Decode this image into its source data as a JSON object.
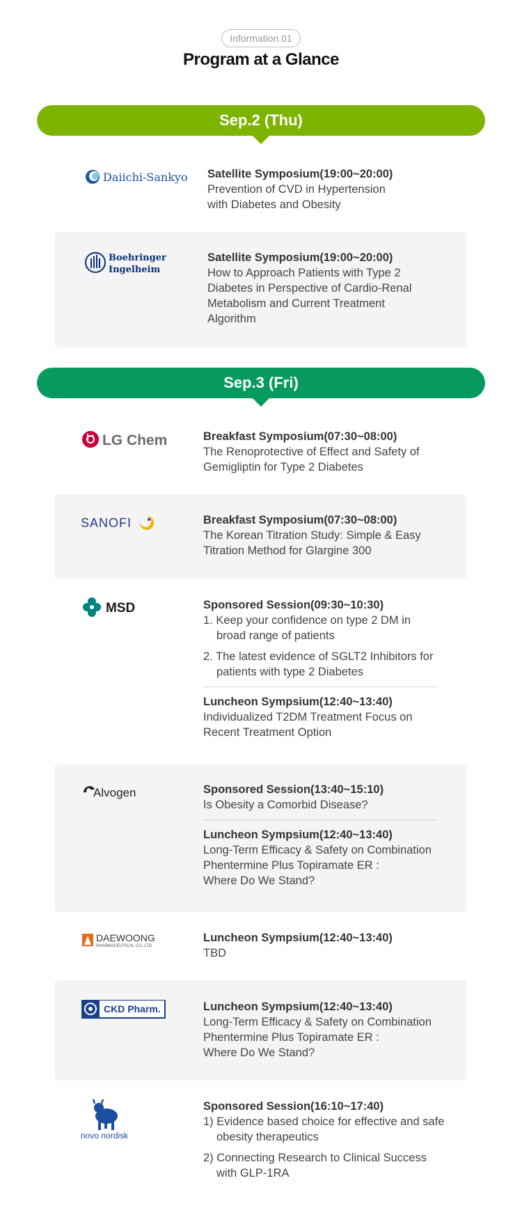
{
  "header": {
    "tag": "Information.01",
    "title": "Program at a Glance"
  },
  "days": [
    {
      "label": "Sep.2 (Thu)",
      "sessions": [
        {
          "sponsor": "Daiichi-Sankyo",
          "heading": "Satellite Symposium(19:00~20:00)",
          "lines": [
            "Prevention of CVD in Hypertension",
            "with Diabetes and Obesity"
          ]
        },
        {
          "sponsor": "Boehringer Ingelheim",
          "sponsor_line1": "Boehringer",
          "sponsor_line2": "Ingelheim",
          "heading": "Satellite Symposium(19:00~20:00)",
          "lines": [
            "How to Approach Patients with Type 2",
            "Diabetes in Perspective of Cardio-Renal",
            "Metabolism and Current Treatment",
            "Algorithm"
          ]
        }
      ]
    },
    {
      "label": "Sep.3 (Fri)",
      "sessions": [
        {
          "sponsor": "LG Chem",
          "heading": "Breakfast Symposium(07:30~08:00)",
          "lines": [
            "The Renoprotective of Effect and Safety of",
            "Gemigliptin for Type 2 Diabetes"
          ]
        },
        {
          "sponsor": "SANOFI",
          "heading": "Breakfast Symposium(07:30~08:00)",
          "lines": [
            "The Korean Titration Study: Simple & Easy",
            "Titration Method for Glargine 300"
          ]
        },
        {
          "sponsor": "MSD",
          "heading": "Sponsored Session(09:30~10:30)",
          "items": [
            "1. Keep your confidence on type 2 DM in broad range of patients",
            "2. The latest evidence of SGLT2 Inhibitors for patients with type 2 Diabetes"
          ],
          "heading2": "Luncheon Sympsium(12:40~13:40)",
          "lines2": [
            "Individualized T2DM Treatment Focus on",
            "Recent Treatment Option"
          ]
        },
        {
          "sponsor": "Alvogen",
          "heading": "Sponsored Session(13:40~15:10)",
          "lines": [
            "Is Obesity a Comorbid Disease?"
          ],
          "heading2": "Luncheon Sympsium(12:40~13:40)",
          "lines2": [
            "Long-Term Efficacy & Safety on Combination",
            "Phentermine Plus Topiramate ER :",
            "Where Do We Stand?"
          ]
        },
        {
          "sponsor": "DAEWOONG",
          "sponsor_sub": "PHARMACEUTICAL CO.,LTD.",
          "heading": "Luncheon Sympsium(12:40~13:40)",
          "lines": [
            "TBD"
          ]
        },
        {
          "sponsor": "CKD Pharm.",
          "heading": "Luncheon Sympsium(12:40~13:40)",
          "lines": [
            "Long-Term Efficacy & Safety on Combination",
            "Phentermine Plus Topiramate ER :",
            "Where Do We Stand?"
          ]
        },
        {
          "sponsor": "novo nordisk",
          "heading": "Sponsored Session(16:10~17:40)",
          "items": [
            "1) Evidence based choice for effective and safe obesity therapeutics",
            "2) Connecting Research to Clinical Success with GLP-1RA"
          ]
        }
      ]
    }
  ],
  "colors": {
    "day1": "#7db400",
    "day2": "#079a5f",
    "panel": "#f4f4f4"
  }
}
